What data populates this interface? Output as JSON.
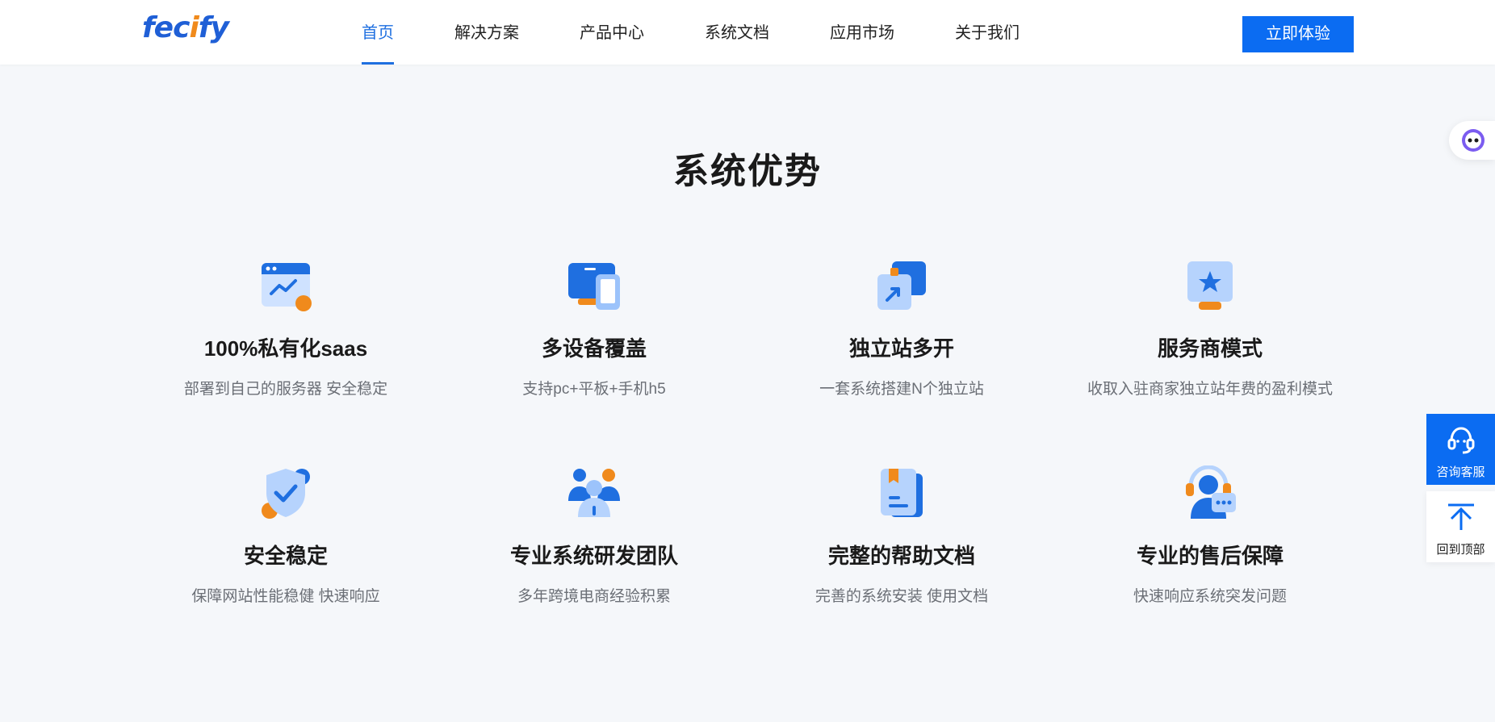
{
  "header": {
    "logo_text": "fecify",
    "nav": [
      {
        "label": "首页",
        "active": true
      },
      {
        "label": "解决方案",
        "active": false
      },
      {
        "label": "产品中心",
        "active": false
      },
      {
        "label": "系统文档",
        "active": false
      },
      {
        "label": "应用市场",
        "active": false
      },
      {
        "label": "关于我们",
        "active": false
      }
    ],
    "cta_label": "立即体验"
  },
  "section": {
    "title": "系统优势"
  },
  "features": [
    {
      "icon": "chart-window-icon",
      "title": "100%私有化saas",
      "desc": "部署到自己的服务器 安全稳定"
    },
    {
      "icon": "multi-device-icon",
      "title": "多设备覆盖",
      "desc": "支持pc+平板+手机h5"
    },
    {
      "icon": "multi-site-icon",
      "title": "独立站多开",
      "desc": "一套系统搭建N个独立站"
    },
    {
      "icon": "star-display-icon",
      "title": "服务商模式",
      "desc": "收取入驻商家独立站年费的盈利模式"
    },
    {
      "icon": "shield-check-icon",
      "title": "安全稳定",
      "desc": "保障网站性能稳健 快速响应"
    },
    {
      "icon": "team-icon",
      "title": "专业系统研发团队",
      "desc": "多年跨境电商经验积累"
    },
    {
      "icon": "document-icon",
      "title": "完整的帮助文档",
      "desc": "完善的系统安装 使用文档"
    },
    {
      "icon": "support-agent-icon",
      "title": "专业的售后保障",
      "desc": "快速响应系统突发问题"
    }
  ],
  "sidebar": {
    "consult_label": "咨询客服",
    "top_label": "回到顶部"
  },
  "colors": {
    "primary": "#0b6cf2",
    "accent": "#f08a1c",
    "background": "#f5f7fa"
  }
}
